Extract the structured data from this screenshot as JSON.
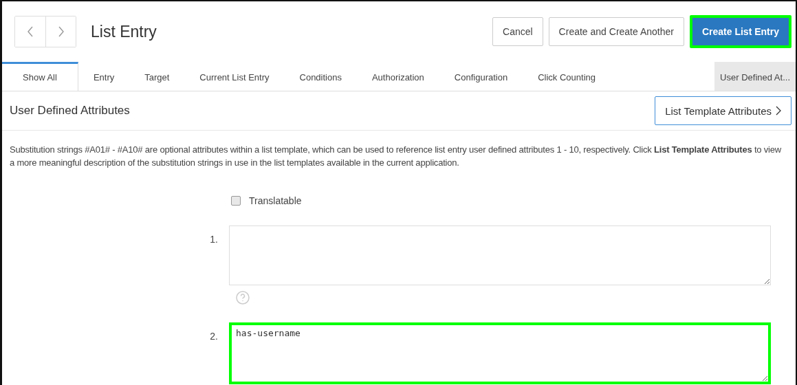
{
  "header": {
    "title": "List Entry",
    "buttons": [
      {
        "label": "Cancel",
        "primary": false,
        "highlighted": false
      },
      {
        "label": "Create and Create Another",
        "primary": false,
        "highlighted": false
      },
      {
        "label": "Create List Entry",
        "primary": true,
        "highlighted": true
      }
    ]
  },
  "tabs": [
    {
      "label": "Show All",
      "selected": true,
      "current": false
    },
    {
      "label": "Entry",
      "selected": false,
      "current": false
    },
    {
      "label": "Target",
      "selected": false,
      "current": false
    },
    {
      "label": "Current List Entry",
      "selected": false,
      "current": false
    },
    {
      "label": "Conditions",
      "selected": false,
      "current": false
    },
    {
      "label": "Authorization",
      "selected": false,
      "current": false
    },
    {
      "label": "Configuration",
      "selected": false,
      "current": false
    },
    {
      "label": "Click Counting",
      "selected": false,
      "current": false
    },
    {
      "label": "User Defined At...",
      "selected": false,
      "current": true
    }
  ],
  "section": {
    "title": "User Defined Attributes",
    "button": "List Template Attributes",
    "description": "Substitution strings #A01# - #A10# are optional attributes within a list template, which can be used to reference list entry user defined attributes 1 - 10, respectively. Click **List Template Attributes** to view a more meaningful description of the substitution strings in use in the list templates available in the current application.",
    "translatable": {
      "label": "Translatable",
      "checked": false
    },
    "attributes": [
      {
        "label": "1.",
        "highlighted": false,
        "help": true
      },
      {
        "label": "2.",
        "value": "has-username",
        "highlighted": true,
        "help": false
      }
    ]
  }
}
